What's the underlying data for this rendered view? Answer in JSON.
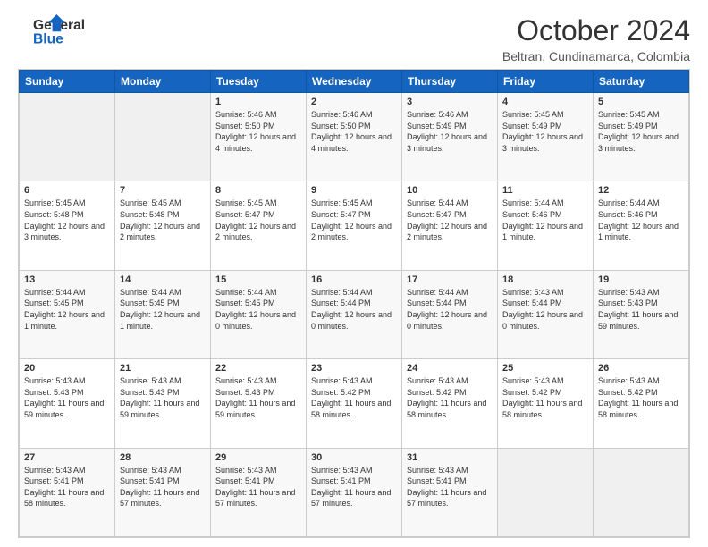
{
  "logo": {
    "line1": "General",
    "line2": "Blue"
  },
  "header": {
    "month": "October 2024",
    "location": "Beltran, Cundinamarca, Colombia"
  },
  "weekdays": [
    "Sunday",
    "Monday",
    "Tuesday",
    "Wednesday",
    "Thursday",
    "Friday",
    "Saturday"
  ],
  "weeks": [
    [
      {
        "day": "",
        "empty": true
      },
      {
        "day": "",
        "empty": true
      },
      {
        "day": "1",
        "rise": "5:46 AM",
        "set": "5:50 PM",
        "daylight": "12 hours and 4 minutes."
      },
      {
        "day": "2",
        "rise": "5:46 AM",
        "set": "5:50 PM",
        "daylight": "12 hours and 4 minutes."
      },
      {
        "day": "3",
        "rise": "5:46 AM",
        "set": "5:49 PM",
        "daylight": "12 hours and 3 minutes."
      },
      {
        "day": "4",
        "rise": "5:45 AM",
        "set": "5:49 PM",
        "daylight": "12 hours and 3 minutes."
      },
      {
        "day": "5",
        "rise": "5:45 AM",
        "set": "5:49 PM",
        "daylight": "12 hours and 3 minutes."
      }
    ],
    [
      {
        "day": "6",
        "rise": "5:45 AM",
        "set": "5:48 PM",
        "daylight": "12 hours and 3 minutes."
      },
      {
        "day": "7",
        "rise": "5:45 AM",
        "set": "5:48 PM",
        "daylight": "12 hours and 2 minutes."
      },
      {
        "day": "8",
        "rise": "5:45 AM",
        "set": "5:47 PM",
        "daylight": "12 hours and 2 minutes."
      },
      {
        "day": "9",
        "rise": "5:45 AM",
        "set": "5:47 PM",
        "daylight": "12 hours and 2 minutes."
      },
      {
        "day": "10",
        "rise": "5:44 AM",
        "set": "5:47 PM",
        "daylight": "12 hours and 2 minutes."
      },
      {
        "day": "11",
        "rise": "5:44 AM",
        "set": "5:46 PM",
        "daylight": "12 hours and 1 minute."
      },
      {
        "day": "12",
        "rise": "5:44 AM",
        "set": "5:46 PM",
        "daylight": "12 hours and 1 minute."
      }
    ],
    [
      {
        "day": "13",
        "rise": "5:44 AM",
        "set": "5:45 PM",
        "daylight": "12 hours and 1 minute."
      },
      {
        "day": "14",
        "rise": "5:44 AM",
        "set": "5:45 PM",
        "daylight": "12 hours and 1 minute."
      },
      {
        "day": "15",
        "rise": "5:44 AM",
        "set": "5:45 PM",
        "daylight": "12 hours and 0 minutes."
      },
      {
        "day": "16",
        "rise": "5:44 AM",
        "set": "5:44 PM",
        "daylight": "12 hours and 0 minutes."
      },
      {
        "day": "17",
        "rise": "5:44 AM",
        "set": "5:44 PM",
        "daylight": "12 hours and 0 minutes."
      },
      {
        "day": "18",
        "rise": "5:43 AM",
        "set": "5:44 PM",
        "daylight": "12 hours and 0 minutes."
      },
      {
        "day": "19",
        "rise": "5:43 AM",
        "set": "5:43 PM",
        "daylight": "11 hours and 59 minutes."
      }
    ],
    [
      {
        "day": "20",
        "rise": "5:43 AM",
        "set": "5:43 PM",
        "daylight": "11 hours and 59 minutes."
      },
      {
        "day": "21",
        "rise": "5:43 AM",
        "set": "5:43 PM",
        "daylight": "11 hours and 59 minutes."
      },
      {
        "day": "22",
        "rise": "5:43 AM",
        "set": "5:43 PM",
        "daylight": "11 hours and 59 minutes."
      },
      {
        "day": "23",
        "rise": "5:43 AM",
        "set": "5:42 PM",
        "daylight": "11 hours and 58 minutes."
      },
      {
        "day": "24",
        "rise": "5:43 AM",
        "set": "5:42 PM",
        "daylight": "11 hours and 58 minutes."
      },
      {
        "day": "25",
        "rise": "5:43 AM",
        "set": "5:42 PM",
        "daylight": "11 hours and 58 minutes."
      },
      {
        "day": "26",
        "rise": "5:43 AM",
        "set": "5:42 PM",
        "daylight": "11 hours and 58 minutes."
      }
    ],
    [
      {
        "day": "27",
        "rise": "5:43 AM",
        "set": "5:41 PM",
        "daylight": "11 hours and 58 minutes."
      },
      {
        "day": "28",
        "rise": "5:43 AM",
        "set": "5:41 PM",
        "daylight": "11 hours and 57 minutes."
      },
      {
        "day": "29",
        "rise": "5:43 AM",
        "set": "5:41 PM",
        "daylight": "11 hours and 57 minutes."
      },
      {
        "day": "30",
        "rise": "5:43 AM",
        "set": "5:41 PM",
        "daylight": "11 hours and 57 minutes."
      },
      {
        "day": "31",
        "rise": "5:43 AM",
        "set": "5:41 PM",
        "daylight": "11 hours and 57 minutes."
      },
      {
        "day": "",
        "empty": true
      },
      {
        "day": "",
        "empty": true
      }
    ]
  ],
  "labels": {
    "sunrise": "Sunrise:",
    "sunset": "Sunset:",
    "daylight": "Daylight:"
  }
}
